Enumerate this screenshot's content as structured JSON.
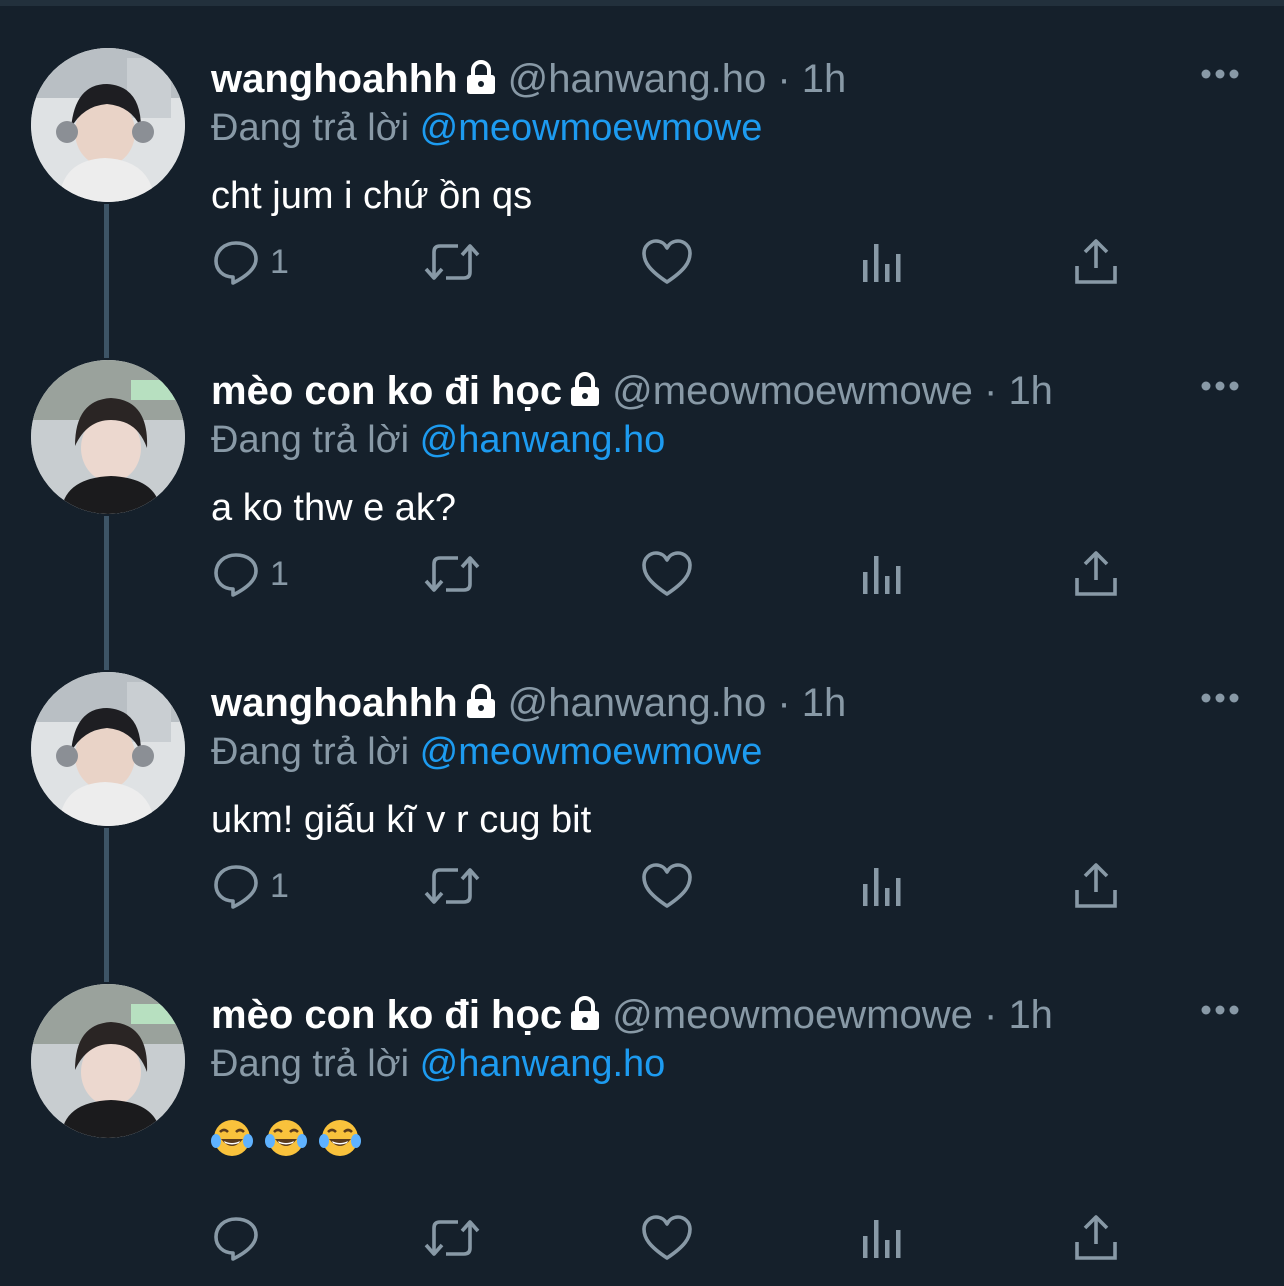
{
  "tweets": [
    {
      "name": "wanghoahhh",
      "handle": "@hanwang.ho",
      "dot": "·",
      "time": "1h",
      "replying_prefix": "Đang trả lời",
      "replying_to": "@meowmoewmowe",
      "text": "cht jum i chứ ồn qs",
      "reply_count": "1"
    },
    {
      "name": "mèo con ko đi học",
      "handle": "@meowmoewmowe",
      "dot": "·",
      "time": "1h",
      "replying_prefix": "Đang trả lời",
      "replying_to": "@hanwang.ho",
      "text": "a ko thw e ak?",
      "reply_count": "1"
    },
    {
      "name": "wanghoahhh",
      "handle": "@hanwang.ho",
      "dot": "·",
      "time": "1h",
      "replying_prefix": "Đang trả lời",
      "replying_to": "@meowmoewmowe",
      "text": "ukm! giấu kĩ v r cug bit",
      "reply_count": "1"
    },
    {
      "name": "mèo con ko đi học",
      "handle": "@meowmoewmowe",
      "dot": "·",
      "time": "1h",
      "replying_prefix": "Đang trả lời",
      "replying_to": "@hanwang.ho",
      "text": "😂😂😂",
      "reply_count": ""
    }
  ],
  "colors": {
    "background": "#15202b",
    "text": "#ffffff",
    "secondary": "#8899a6",
    "mention": "#1d9bf0",
    "thread_line": "#3d5466"
  },
  "icons": [
    "lock-icon",
    "more-icon",
    "reply-icon",
    "retweet-icon",
    "like-icon",
    "analytics-icon",
    "share-icon",
    "tears-of-joy-emoji"
  ]
}
